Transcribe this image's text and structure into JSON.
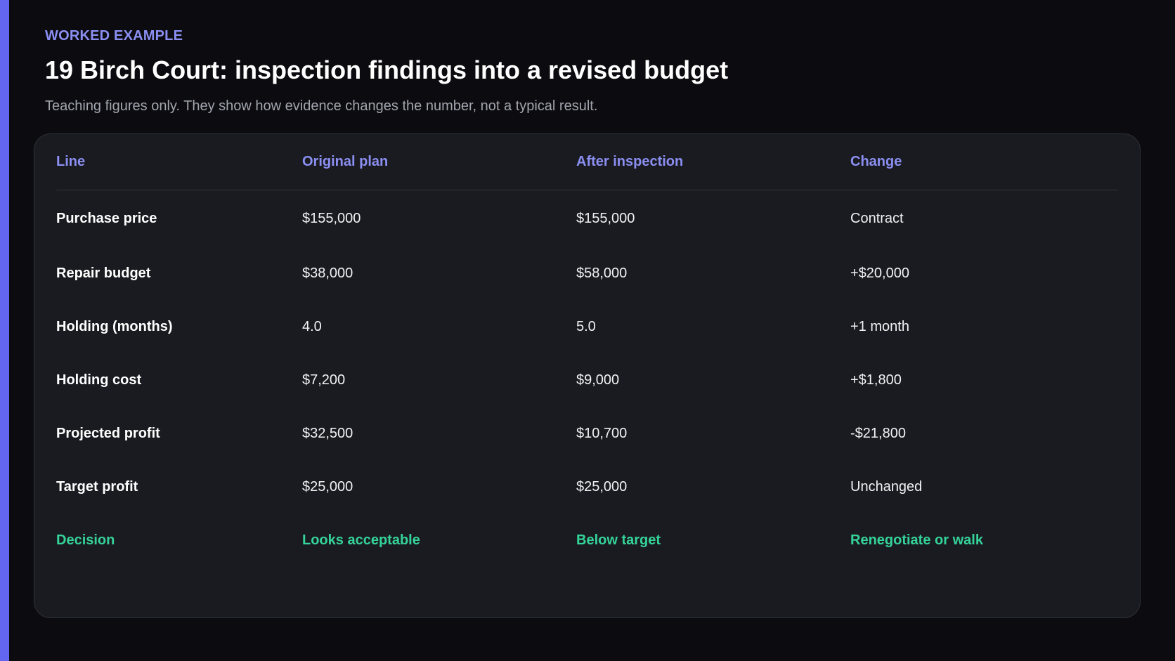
{
  "header": {
    "eyebrow": "WORKED EXAMPLE",
    "title": "19 Birch Court: inspection findings into a revised budget",
    "subtitle": "Teaching figures only. They show how evidence changes the number, not a typical result."
  },
  "table": {
    "columns": [
      "Line",
      "Original plan",
      "After inspection",
      "Change"
    ],
    "rows": [
      {
        "line": "Purchase price",
        "original": "$155,000",
        "after": "$155,000",
        "change": "Contract"
      },
      {
        "line": "Repair budget",
        "original": "$38,000",
        "after": "$58,000",
        "change": "+$20,000"
      },
      {
        "line": "Holding (months)",
        "original": "4.0",
        "after": "5.0",
        "change": "+1 month"
      },
      {
        "line": "Holding cost",
        "original": "$7,200",
        "after": "$9,000",
        "change": "+$1,800"
      },
      {
        "line": "Projected profit",
        "original": "$32,500",
        "after": "$10,700",
        "change": "-$21,800"
      },
      {
        "line": "Target profit",
        "original": "$25,000",
        "after": "$25,000",
        "change": "Unchanged"
      }
    ],
    "decision": {
      "line": "Decision",
      "original": "Looks acceptable",
      "after": "Below target",
      "change": "Renegotiate or walk"
    }
  },
  "colors": {
    "accent": "#6366f1",
    "header_text": "#8b8ff2",
    "decision_text": "#34d399",
    "background": "#0c0c10",
    "panel": "#1a1b20"
  }
}
